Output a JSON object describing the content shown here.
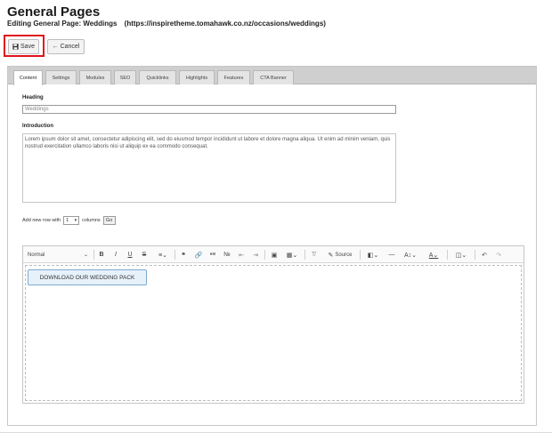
{
  "header": {
    "title": "General Pages",
    "subtitle": "Editing General Page: Weddings",
    "url": "(https://inspiretheme.tomahawk.co.nz/occasions/weddings)"
  },
  "actions": {
    "save_label": "Save",
    "cancel_label": "Cancel"
  },
  "tabs": [
    {
      "label": "Content",
      "active": true
    },
    {
      "label": "Settings"
    },
    {
      "label": "Modules"
    },
    {
      "label": "SEO"
    },
    {
      "label": "Quicklinks"
    },
    {
      "label": "Highlights"
    },
    {
      "label": "Features"
    },
    {
      "label": "CTA Banner"
    }
  ],
  "form": {
    "heading_label": "Heading",
    "heading_value": "Weddings",
    "intro_label": "Introduction",
    "intro_value": "Lorem ipsum dolor sit amet, consectetur adipiscing elit, sed do eiusmod tempor incididunt ut labore et dolore magna aliqua. Ut enim ad minim veniam, quis nostrud exercitation ullamco laboris nisi ut aliquip ex ea commodo consequat.",
    "add_row_prefix": "Add new row with",
    "columns_value": "1",
    "columns_suffix": "columns",
    "go_label": "Go"
  },
  "editor": {
    "format_select": "Normal",
    "bold": "B",
    "italic": "I",
    "underline": "U",
    "strike": "S",
    "source_label": "Source",
    "content_button": "DOWNLOAD OUR WEDDING PACK"
  },
  "colors": {
    "highlight": "#e0131b",
    "cta_bg": "#e7f1fa",
    "cta_border": "#7fa9cf"
  }
}
